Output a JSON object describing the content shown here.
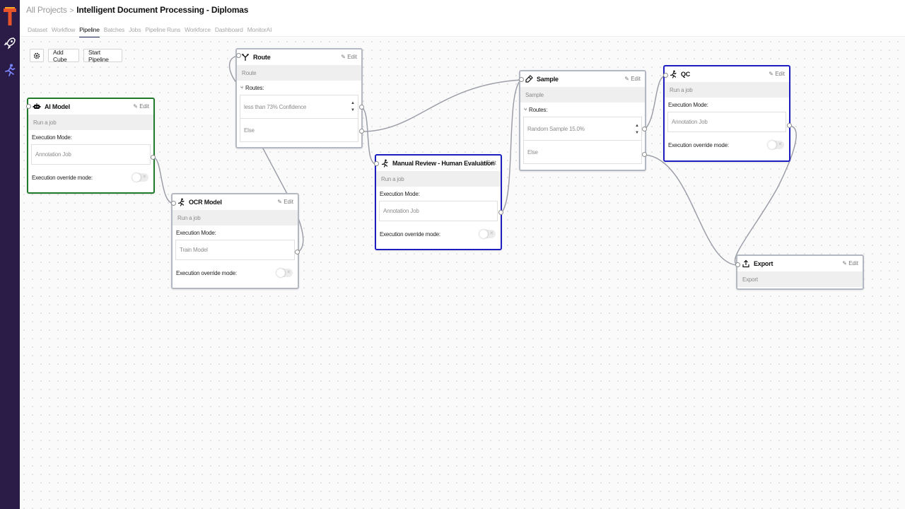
{
  "app": {
    "accent": "#2a1b47",
    "node_border_green": "#1f7a2a",
    "node_border_blue": "#1c1ec2",
    "node_border_gray": "#b4b8c2"
  },
  "sidebar": {
    "icons": [
      "logo-icon",
      "rocket-icon",
      "runner-icon"
    ]
  },
  "breadcrumb": {
    "root": "All Projects",
    "separator": ">",
    "current": "Intelligent Document Processing - Diplomas"
  },
  "tabs": [
    "Dataset",
    "Workflow",
    "Pipeline",
    "Batches",
    "Jobs",
    "Pipeline Runs",
    "Workforce",
    "Dashboard",
    "MonitorAI"
  ],
  "active_tab": "Pipeline",
  "toolbar": {
    "settings_icon": "gear-icon",
    "add_cube": "Add Cube",
    "start_pipeline": "Start Pipeline"
  },
  "common": {
    "edit": "Edit",
    "execution_mode": "Execution Mode:",
    "execution_override": "Execution override mode:",
    "routes": "Routes:",
    "toggle_x": "✕"
  },
  "nodes": {
    "ai_model": {
      "title": "AI Model",
      "subtitle": "Run a job",
      "mode": "Annotation Job",
      "icon": "robot-icon"
    },
    "ocr_model": {
      "title": "OCR Model",
      "subtitle": "Run a job",
      "mode": "Train Model",
      "icon": "runner-icon"
    },
    "route": {
      "title": "Route",
      "subtitle": "Route",
      "route1": "less than 73% Confidence",
      "else": "Else",
      "icon": "route-icon"
    },
    "manual_review": {
      "title": "Manual Review - Human Evaluation",
      "subtitle": "Run a job",
      "mode": "Annotation Job",
      "icon": "runner-icon"
    },
    "sample": {
      "title": "Sample",
      "subtitle": "Sample",
      "route1": "Random Sample 15.0%",
      "else": "Else",
      "icon": "sample-icon"
    },
    "qc": {
      "title": "QC",
      "subtitle": "Run a job",
      "mode": "Annotation Job",
      "icon": "runner-icon"
    },
    "export": {
      "title": "Export",
      "subtitle": "Export",
      "icon": "export-icon"
    }
  }
}
